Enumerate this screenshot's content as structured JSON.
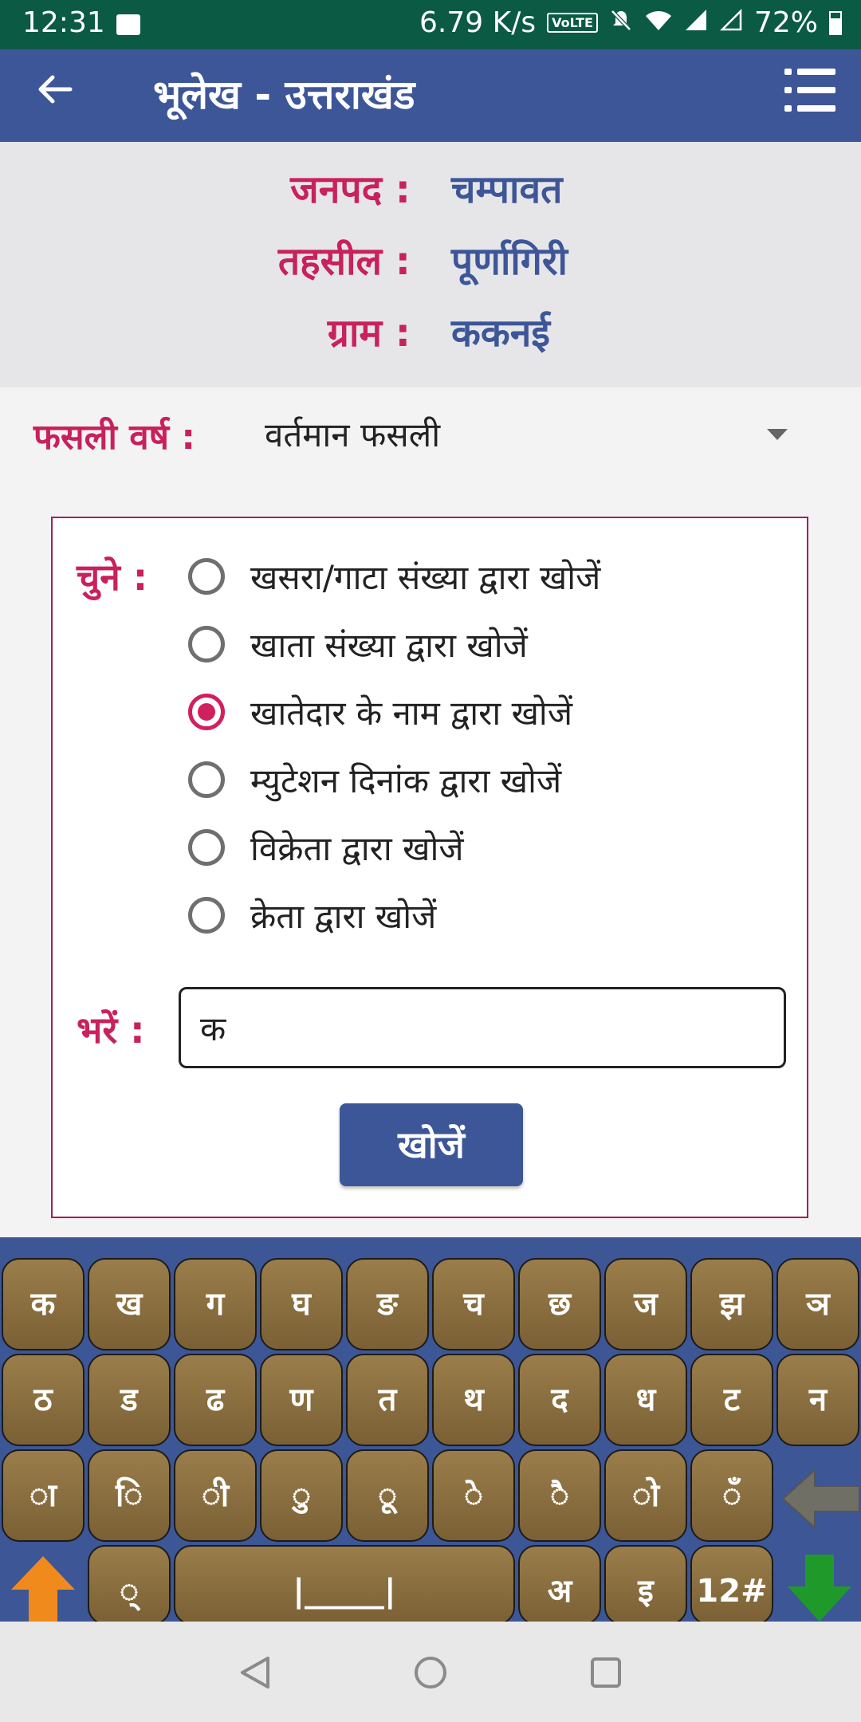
{
  "status_bar": {
    "time": "12:31",
    "net_speed": "6.79 K/s",
    "volte": "VoLTE",
    "battery": "72%",
    "icons": [
      "gallery-icon",
      "mute-icon",
      "wifi-icon",
      "signal-icon",
      "signal-empty-icon",
      "battery-icon"
    ]
  },
  "app_bar": {
    "title": "भूलेख - उत्तराखंड",
    "back_icon": "arrow-left-icon",
    "menu_icon": "list-menu-icon"
  },
  "location": {
    "district_label": "जनपद :",
    "district": "चम्पावत",
    "tehsil_label": "तहसील :",
    "tehsil": "पूर्णागिरी",
    "village_label": "ग्राम :",
    "village": "ककनई"
  },
  "crop_year": {
    "label": "फसली वर्ष :",
    "selected": "वर्तमान फसली"
  },
  "search_form": {
    "choose_label": "चुने :",
    "options": [
      {
        "label": "खसरा/गाटा संख्या द्वारा खोजें",
        "selected": false
      },
      {
        "label": "खाता संख्या द्वारा खोजें",
        "selected": false
      },
      {
        "label": "खातेदार के नाम द्वारा खोजें",
        "selected": true
      },
      {
        "label": "म्युटेशन दिनांक द्वारा खोजें",
        "selected": false
      },
      {
        "label": "विक्रेता द्वारा खोजें",
        "selected": false
      },
      {
        "label": "क्रेता द्वारा खोजें",
        "selected": false
      }
    ],
    "fill_label": "भरें :",
    "input_value": "क",
    "search_button": "खोजें"
  },
  "keyboard": {
    "row1": [
      "क",
      "ख",
      "ग",
      "घ",
      "ङ",
      "च",
      "छ",
      "ज",
      "झ",
      "ञ"
    ],
    "row2": [
      "ठ",
      "ड",
      "ढ",
      "ण",
      "त",
      "थ",
      "द",
      "ध",
      "ट",
      "न"
    ],
    "row3": [
      "◌ा",
      "◌ि",
      "◌ी",
      "◌ु",
      "◌ू",
      "◌े",
      "◌ै",
      "◌ो",
      "◌ँ"
    ],
    "row4": [
      "◌्",
      "|_____|",
      "अ",
      "इ",
      "12#"
    ],
    "colors": {
      "key": "#8a6f40",
      "shift": "#f08a1c",
      "enter": "#1f9a2a",
      "background": "#3c5696"
    }
  },
  "nav_bar": {
    "icons": [
      "back-triangle-icon",
      "home-circle-icon",
      "recents-square-icon"
    ]
  },
  "colors": {
    "app_bar": "#3d5698",
    "status_bar": "#0b5a43",
    "label_accent": "#c8215c",
    "value_accent": "#3d5698",
    "radio_selected": "#d21f5f"
  }
}
